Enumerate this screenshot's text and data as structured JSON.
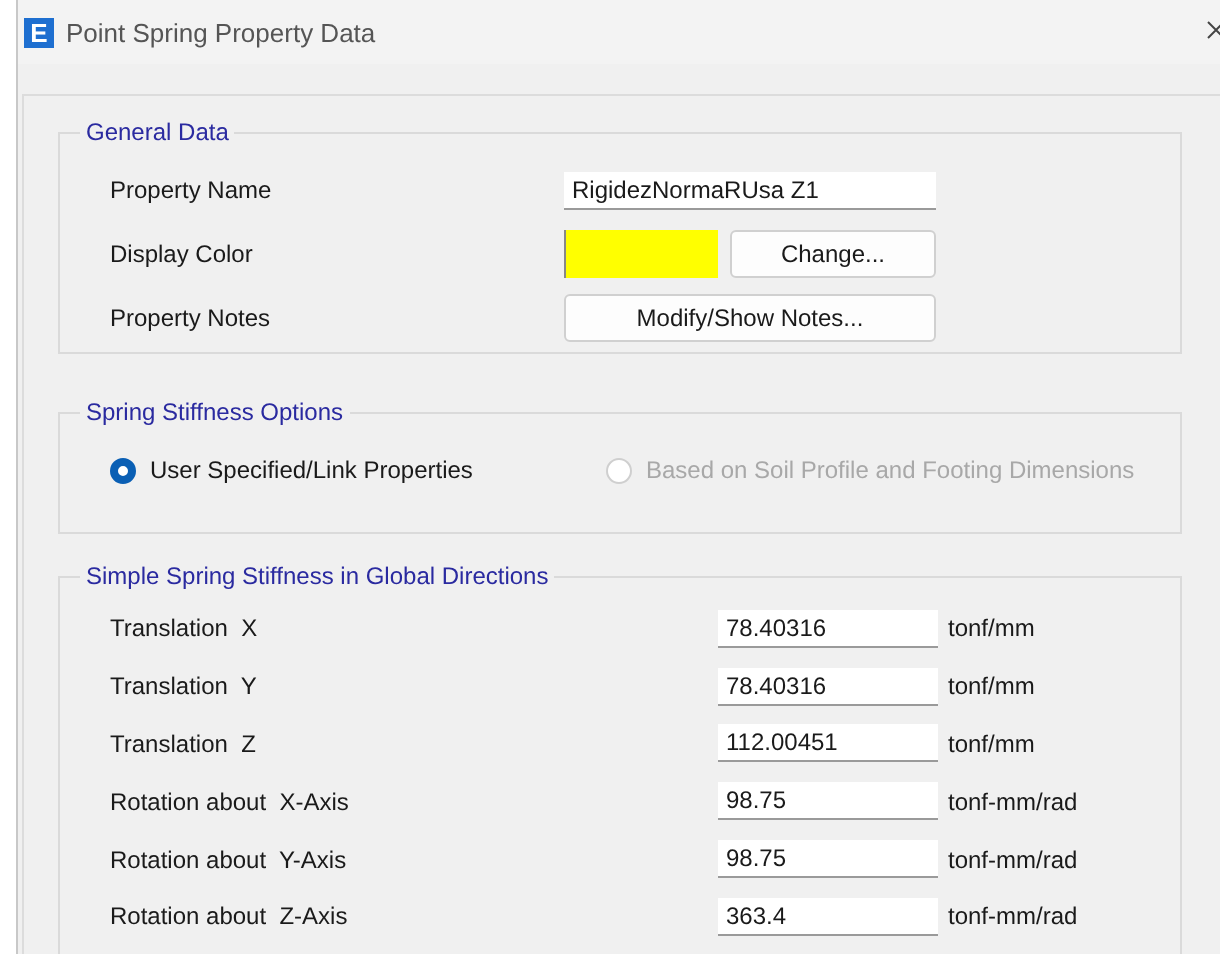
{
  "window": {
    "icon_letter": "E",
    "title": "Point Spring Property Data"
  },
  "general_data": {
    "title": "General Data",
    "property_name": {
      "label": "Property Name",
      "value": "RigidezNormaRUsa Z1"
    },
    "display_color": {
      "label": "Display Color",
      "color": "#ffff00",
      "button": "Change..."
    },
    "property_notes": {
      "label": "Property Notes",
      "button": "Modify/Show Notes..."
    }
  },
  "stiffness_options": {
    "title": "Spring Stiffness Options",
    "options": [
      {
        "label": "User Specified/Link Properties",
        "selected": true,
        "disabled": false
      },
      {
        "label": "Based on Soil Profile and Footing Dimensions",
        "selected": false,
        "disabled": true
      }
    ]
  },
  "global_stiffness": {
    "title": "Simple Spring Stiffness in Global Directions",
    "rows": [
      {
        "label": "Translation  X",
        "value": "78.40316",
        "unit": "tonf/mm"
      },
      {
        "label": "Translation  Y",
        "value": "78.40316",
        "unit": "tonf/mm"
      },
      {
        "label": "Translation  Z",
        "value": "112.00451",
        "unit": "tonf/mm"
      },
      {
        "label": "Rotation about  X-Axis",
        "value": "98.75",
        "unit": "tonf-mm/rad"
      },
      {
        "label": "Rotation about  Y-Axis",
        "value": "98.75",
        "unit": "tonf-mm/rad"
      },
      {
        "label": "Rotation about  Z-Axis",
        "value": "363.4",
        "unit": "tonf-mm/rad"
      }
    ]
  }
}
